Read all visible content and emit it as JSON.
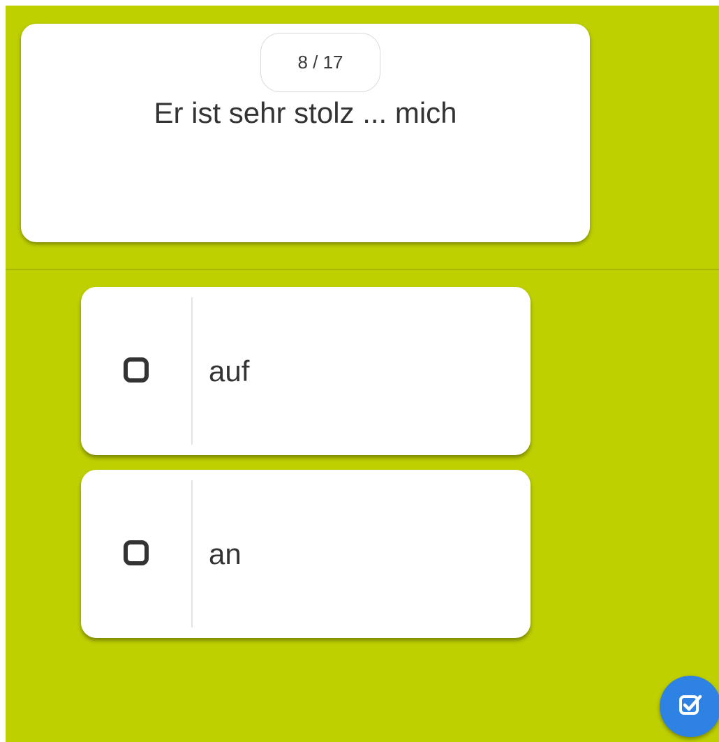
{
  "quiz": {
    "progress": "8 / 17",
    "question": "Er ist sehr stolz ... mich",
    "answers": [
      {
        "label": "auf",
        "checked": false
      },
      {
        "label": "an",
        "checked": false
      }
    ]
  },
  "submit_button": {
    "icon": "checkbox-check-icon"
  },
  "colors": {
    "background": "#bed000",
    "card": "#ffffff",
    "text": "#333333",
    "accent": "#2e82e3"
  }
}
